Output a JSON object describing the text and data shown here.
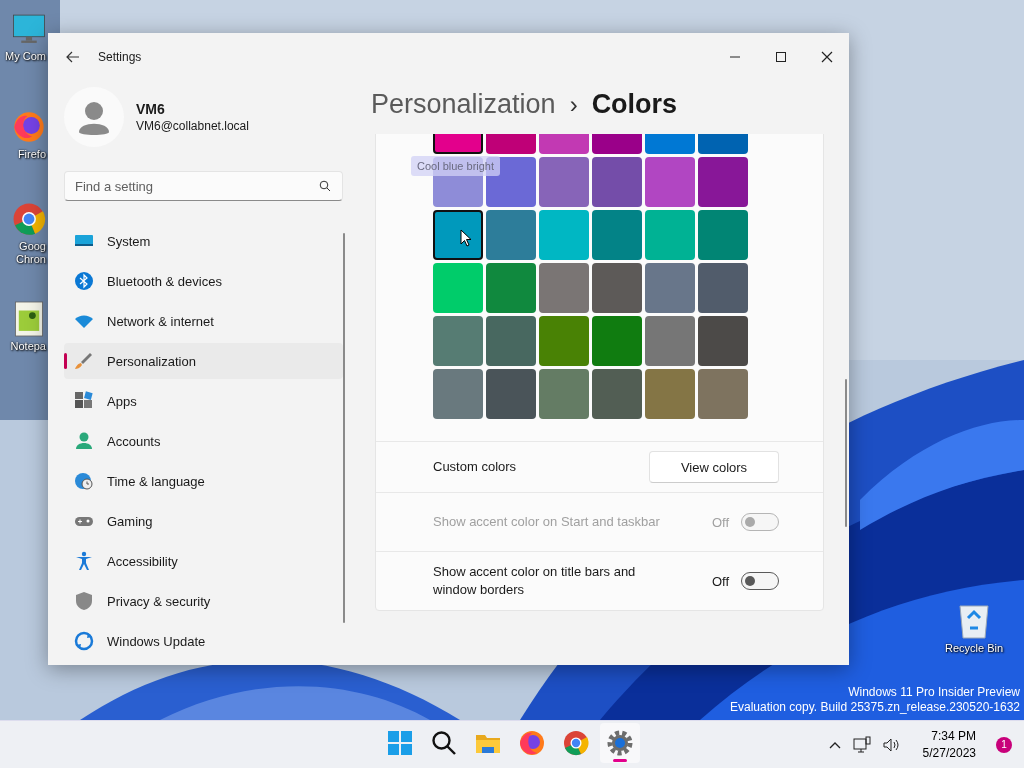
{
  "desktop_icons": [
    {
      "label": "My Com"
    },
    {
      "label": "Firefo"
    },
    {
      "label": "Goog Chron"
    },
    {
      "label": "Notepa"
    },
    {
      "label": "Recycle Bin"
    }
  ],
  "window": {
    "title": "Settings"
  },
  "user": {
    "name": "VM6",
    "email": "VM6@collabnet.local"
  },
  "search": {
    "placeholder": "Find a setting"
  },
  "sidebar": {
    "items": [
      {
        "label": "System",
        "selected": false
      },
      {
        "label": "Bluetooth & devices",
        "selected": false
      },
      {
        "label": "Network & internet",
        "selected": false
      },
      {
        "label": "Personalization",
        "selected": true
      },
      {
        "label": "Apps",
        "selected": false
      },
      {
        "label": "Accounts",
        "selected": false
      },
      {
        "label": "Time & language",
        "selected": false
      },
      {
        "label": "Gaming",
        "selected": false
      },
      {
        "label": "Accessibility",
        "selected": false
      },
      {
        "label": "Privacy & security",
        "selected": false
      },
      {
        "label": "Windows Update",
        "selected": false
      }
    ]
  },
  "breadcrumb": {
    "parent": "Personalization",
    "separator": "›",
    "current": "Colors"
  },
  "color_grid": {
    "tooltip": "Cool blue bright",
    "swatches": [
      {
        "color": "#e3008c",
        "selected": true,
        "hovered": false
      },
      {
        "color": "#bf0077",
        "selected": false,
        "hovered": false
      },
      {
        "color": "#c239b3",
        "selected": false,
        "hovered": false
      },
      {
        "color": "#9a0089",
        "selected": false,
        "hovered": false
      },
      {
        "color": "#0078d4",
        "selected": false,
        "hovered": false
      },
      {
        "color": "#0063b1",
        "selected": false,
        "hovered": false
      },
      {
        "color": "#8e8cd8",
        "selected": false,
        "hovered": false
      },
      {
        "color": "#6b69d6",
        "selected": false,
        "hovered": false
      },
      {
        "color": "#8764b8",
        "selected": false,
        "hovered": false
      },
      {
        "color": "#744da9",
        "selected": false,
        "hovered": false
      },
      {
        "color": "#b146c2",
        "selected": false,
        "hovered": false
      },
      {
        "color": "#881798",
        "selected": false,
        "hovered": false
      },
      {
        "color": "#0099bc",
        "selected": true,
        "hovered": true
      },
      {
        "color": "#2d7d9a",
        "selected": false,
        "hovered": false
      },
      {
        "color": "#00b7c3",
        "selected": false,
        "hovered": false
      },
      {
        "color": "#038387",
        "selected": false,
        "hovered": false
      },
      {
        "color": "#00b294",
        "selected": false,
        "hovered": false
      },
      {
        "color": "#018574",
        "selected": false,
        "hovered": false
      },
      {
        "color": "#00cc6a",
        "selected": false,
        "hovered": false
      },
      {
        "color": "#10893e",
        "selected": false,
        "hovered": false
      },
      {
        "color": "#7a7574",
        "selected": false,
        "hovered": false
      },
      {
        "color": "#5d5a58",
        "selected": false,
        "hovered": false
      },
      {
        "color": "#68768a",
        "selected": false,
        "hovered": false
      },
      {
        "color": "#515c6b",
        "selected": false,
        "hovered": false
      },
      {
        "color": "#567c73",
        "selected": false,
        "hovered": false
      },
      {
        "color": "#486860",
        "selected": false,
        "hovered": false
      },
      {
        "color": "#498205",
        "selected": false,
        "hovered": false
      },
      {
        "color": "#107c10",
        "selected": false,
        "hovered": false
      },
      {
        "color": "#767676",
        "selected": false,
        "hovered": false
      },
      {
        "color": "#4c4a48",
        "selected": false,
        "hovered": false
      },
      {
        "color": "#69797e",
        "selected": false,
        "hovered": false
      },
      {
        "color": "#4a5459",
        "selected": false,
        "hovered": false
      },
      {
        "color": "#647c64",
        "selected": false,
        "hovered": false
      },
      {
        "color": "#525e54",
        "selected": false,
        "hovered": false
      },
      {
        "color": "#847545",
        "selected": false,
        "hovered": false
      },
      {
        "color": "#7e735f",
        "selected": false,
        "hovered": false
      }
    ]
  },
  "settings_rows": [
    {
      "kind": "button",
      "label": "Custom colors",
      "button": "View colors"
    },
    {
      "kind": "toggle",
      "label": "Show accent color on Start and taskbar",
      "state_text": "Off",
      "on": false,
      "disabled": true
    },
    {
      "kind": "toggle",
      "label": "Show accent color on title bars and window borders",
      "state_text": "Off",
      "on": false,
      "disabled": false
    }
  ],
  "watermark": [
    "Windows 11 Pro Insider Preview",
    "Evaluation copy. Build 25375.zn_release.230520-1632"
  ],
  "taskbar": {
    "apps": [
      {
        "selected": false
      },
      {
        "selected": false
      },
      {
        "selected": false
      },
      {
        "selected": false
      },
      {
        "selected": false
      },
      {
        "selected": true
      }
    ],
    "time": "7:34 PM",
    "date": "5/27/2023",
    "notification_count": "1"
  }
}
